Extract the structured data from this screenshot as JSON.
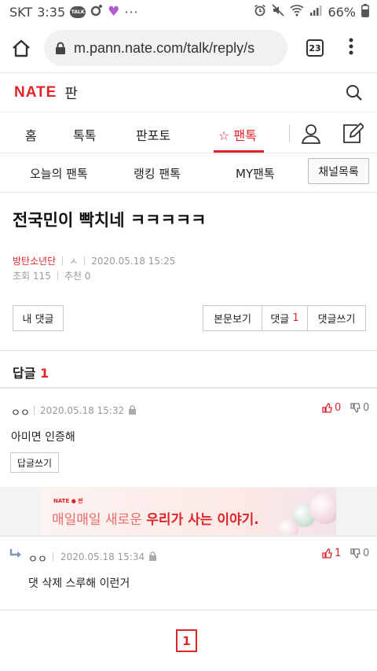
{
  "status_bar": {
    "carrier": "SKT",
    "time": "3:35",
    "talk_badge": "TALK",
    "battery": "66%"
  },
  "browser": {
    "url": "m.pann.nate.com/talk/reply/s",
    "tab_count": "23"
  },
  "nate_header": {
    "logo": "NATE",
    "service": "판"
  },
  "main_nav": [
    "홈",
    "톡톡",
    "판포토",
    "팬톡"
  ],
  "main_nav_active": "☆ 팬톡",
  "sub_nav": {
    "items": [
      "오늘의 팬톡",
      "랭킹 팬톡",
      "MY팬톡"
    ],
    "channel_button": "채널목록"
  },
  "post": {
    "title": "전국민이 빡치네 ㅋㅋㅋㅋㅋ",
    "author": "방탄소년단",
    "author_icon": "ㅅ",
    "date": "2020.05.18 15:25",
    "views_label": "조회",
    "views": "115",
    "likes_label": "추천",
    "likes": "0"
  },
  "actions": {
    "my_comments": "내 댓글",
    "view_post": "본문보기",
    "comments_label": "댓글",
    "comments_count": "1",
    "write_comment": "댓글쓰기"
  },
  "replies_heading": {
    "label": "답글",
    "count": "1"
  },
  "comments": [
    {
      "name": "ㅇㅇ",
      "date": "2020.05.18 15:32",
      "body": "아미면 인증해",
      "up": "0",
      "down": "0",
      "reply_button": "답글쓰기"
    },
    {
      "name": "ㅇㅇ",
      "date": "2020.05.18 15:34",
      "body": "댓 삭제 스루해 이런거",
      "up": "1",
      "down": "0"
    }
  ],
  "ad": {
    "logo": "NATE ● 판",
    "text_plain": "매일매일 새로운 ",
    "text_bold": "우리가 사는 이야기."
  },
  "pagination": {
    "current": "1"
  },
  "colors": {
    "accent": "#e0242a"
  }
}
